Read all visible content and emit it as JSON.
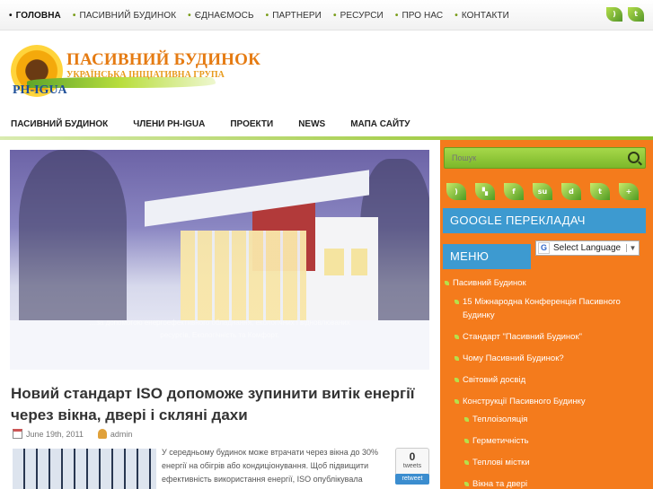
{
  "top_nav": {
    "items": [
      "ГОЛОВНА",
      "ПАСИВНИЙ БУДИНОК",
      "ЄДНАЄМОСЬ",
      "ПАРТНЕРИ",
      "РЕСУРСИ",
      "ПРО НАС",
      "КОНТАКТИ"
    ],
    "active": "ГОЛОВНА",
    "bullet": "•"
  },
  "logo": {
    "title": "ПАСИВНИЙ БУДИНОК",
    "subtitle": "УКРАЇНСЬКА ІНІЦІАТИВНА ГРУПА",
    "abbr": "PH-IGUA"
  },
  "main_nav": [
    "ПАСИВНИЙ БУДИНОК",
    "ЧЛЕНИ PH-IGUA",
    "ПРОЕКТИ",
    "NEWS",
    "МАПА САЙТУ"
  ],
  "hero": {
    "caption": "…за допомогою енергоефективного обладнання, екологічних і відновлюваних ресурсів, Екологічність та Комфорт."
  },
  "post": {
    "title": "Новий стандарт ISO допоможе зупинити витік енергії через вікна, двері і скляні дахи",
    "date": "June 19th, 2011",
    "author": "admin",
    "excerpt": "У середньому будинок може втрачати через вікна до 30% енергії на обігрів   або кондиціонування. Щоб підвищити ефективність використання енергії,      ISO опублікувала",
    "tweet_count": "0",
    "tweet_label": "tweets",
    "retweet_label": "retweet"
  },
  "sidebar": {
    "search_placeholder": "Пошук",
    "social_icons": [
      "rss-icon",
      "delicious-icon",
      "facebook-icon",
      "stumbleupon-icon",
      "digg-icon",
      "technorati-icon",
      "add-icon"
    ],
    "translator_title": "GOOGLE ПЕРЕКЛАДАЧ",
    "language_select": "Select Language",
    "menu_title": "МЕНЮ",
    "menu_items": [
      {
        "label": "Пасивний Будинок",
        "level": 1
      },
      {
        "label": "15 Міжнародна Конференція Пасивного Будинку",
        "level": 2
      },
      {
        "label": "Стандарт \"Пасивний Будинок\"",
        "level": 2
      },
      {
        "label": "Чому Пасивний Будинок?",
        "level": 2
      },
      {
        "label": "Світовий досвід",
        "level": 2
      },
      {
        "label": "Конструкції Пасивного Будинку",
        "level": 2
      },
      {
        "label": "Теплоізоляція",
        "level": 3
      },
      {
        "label": "Герметичність",
        "level": 3
      },
      {
        "label": "Теплові містки",
        "level": 3
      },
      {
        "label": "Вікна та двері",
        "level": 3
      }
    ]
  },
  "colors": {
    "accent_green": "#8bbf2c",
    "sidebar_orange": "#f47b1c",
    "widget_blue": "#3d9ad0",
    "logo_orange": "#e57b12",
    "logo_blue": "#1e4f98"
  }
}
